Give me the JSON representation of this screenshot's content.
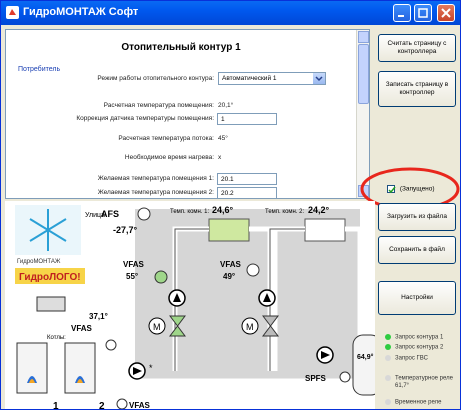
{
  "window": {
    "title": "ГидроМОНТАЖ Софт"
  },
  "content": {
    "heading": "Отопительный контур 1",
    "group_label": "Потребитель",
    "rows": {
      "mode_label": "Режим работы отопительного контура:",
      "mode_value": "Автоматический 1",
      "calc_room_temp_label": "Расчетная температура помещения:",
      "calc_room_temp_value": "20,1°",
      "sensor_corr_label": "Коррекция датчика температуры помещения:",
      "sensor_corr_value": "1",
      "calc_flow_temp_label": "Расчетная температура потока:",
      "calc_flow_temp_value": "45°",
      "heat_time_label": "Необходимое время нагрева:",
      "heat_time_value": "x",
      "desired_temp1_label": "Желаемая температура помещения 1:",
      "desired_temp1_value": "20.1",
      "desired_temp2_label": "Желаемая температура помещения 2:",
      "desired_temp2_value": "20.2"
    }
  },
  "sidebar": {
    "read_button": "Считать страницу с контроллера",
    "write_button": "Записать страницу в контроллер",
    "running_label": "(Запущено)",
    "load_button": "Загрузить из файла",
    "save_button": "Сохранить в файл",
    "settings_button": "Настройки"
  },
  "legend": [
    {
      "label": "Запрос контура 1",
      "color": "#2ecc40"
    },
    {
      "label": "Запрос контура 2",
      "color": "#2ecc40"
    },
    {
      "label": "Запрос ГВС",
      "color": "#d8d8d8"
    },
    {
      "label": "Температурное реле",
      "color": "#d8d8d8"
    },
    {
      "label": "61,7°",
      "color": ""
    },
    {
      "label": "Временное реле",
      "color": "#d8d8d8"
    }
  ],
  "diagram": {
    "outdoor_label": "Улица",
    "afs_label": "AFS",
    "afs_value": "-27,7°",
    "room1_label": "Темп. комн. 1:",
    "room1_value": "24,6°",
    "room2_label": "Темп. комн. 2:",
    "room2_value": "24,2°",
    "vfas1_label": "VFAS",
    "vfas1_value": "55°",
    "vfas2_label": "VFAS",
    "vfas2_value": "49°",
    "vfas3_value": "37,1°",
    "vfas3_label": "VFAS",
    "boilers_label": "Котлы:",
    "boiler1_num": "1",
    "boiler2_num": "2",
    "vfas_bottom": "VFAS",
    "tank_value": "64,9°",
    "spfs_label": "SPFS",
    "brand_small": "ГидроМОНТАЖ",
    "logo_text": "ГидроЛОГО!",
    "motor_label": "M"
  }
}
